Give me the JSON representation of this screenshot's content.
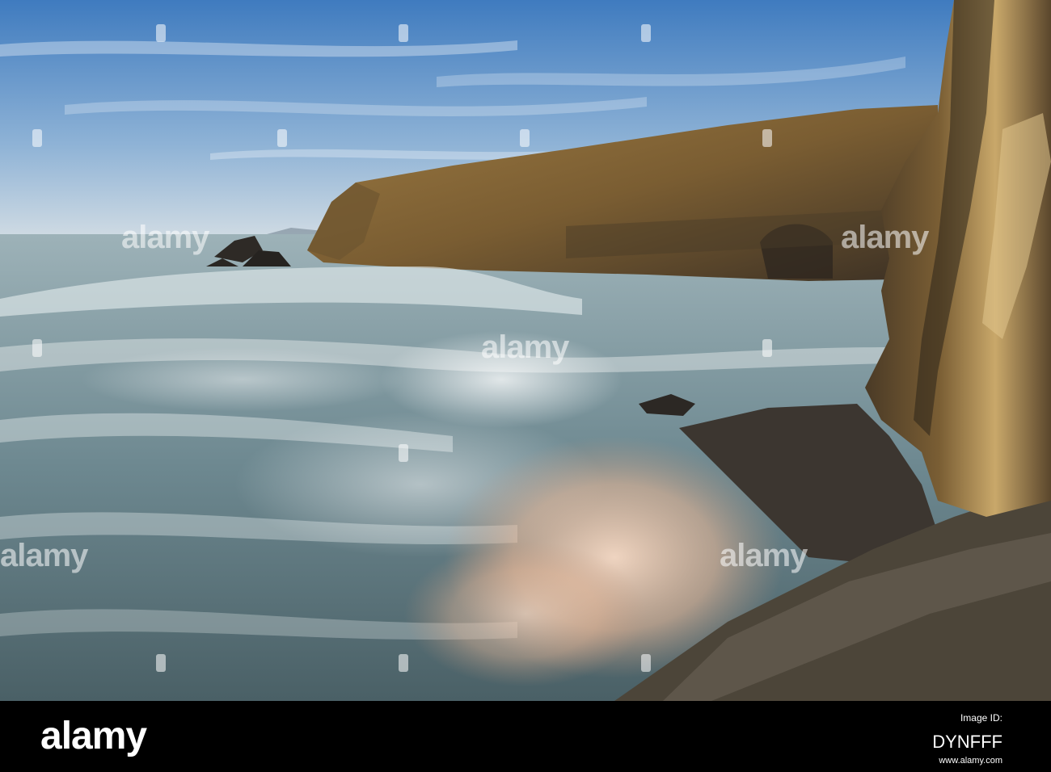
{
  "photo": {
    "subject": "",
    "colors": {
      "sky_top": "#4f87c4",
      "sky_horizon": "#c9d8e4",
      "cliff_lit": "#8a6a38",
      "cliff_shadow": "#3a3226",
      "sea": "#5f7f8a",
      "foam": "#eef2f2",
      "spray_warm": "#f0c8b0",
      "rock_dark": "#2a2622"
    }
  },
  "watermark": {
    "text": "alamy",
    "icon": "alamy-pin-icon"
  },
  "footer": {
    "logo": "alamy",
    "image_id_label": "Image ID:",
    "image_id": "DYNFFF",
    "url": "www.alamy.com"
  }
}
